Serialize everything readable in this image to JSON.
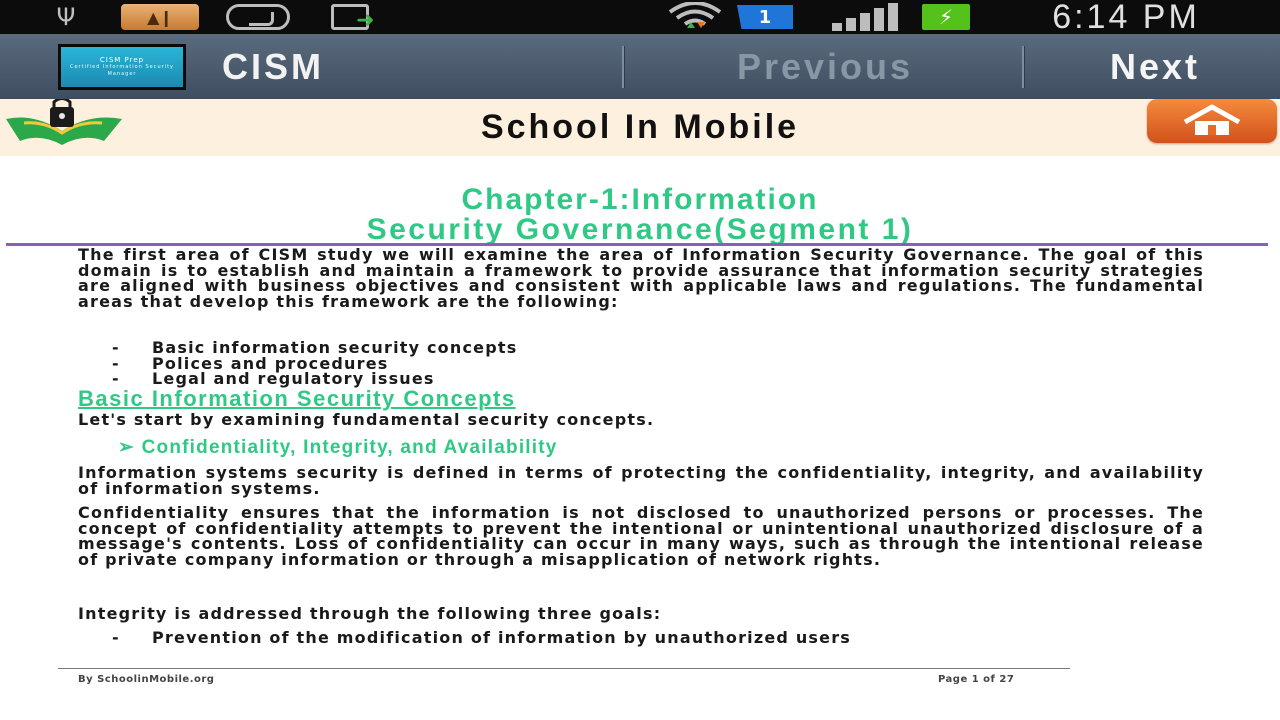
{
  "status_bar": {
    "clock": "6:14 PM",
    "notification_badge": "1",
    "icons": [
      "usb-icon",
      "app-notification-icon",
      "whatsapp-icon",
      "screenshot-icon",
      "wifi-icon",
      "notification-badge",
      "signal-icon",
      "battery-charging-icon"
    ]
  },
  "toolbar": {
    "app_title": "CISM",
    "previous_label": "Previous",
    "next_label": "Next",
    "logo_line1": "CISM Prep",
    "logo_line2": "Certified Information Security Manager"
  },
  "school_header": {
    "title": "School In Mobile",
    "home_icon": "home-icon",
    "logo_icon": "school-lock-book-icon"
  },
  "document": {
    "chapter_title_line1": "Chapter-1:Information",
    "chapter_title_line2": "Security Governance(Segment 1)",
    "intro_paragraph": "The first area of CISM study we will examine the area of Information Security Governance. The goal of this domain is to establish and maintain a framework to provide assurance that information security strategies are aligned with business objectives and consistent with applicable laws and regulations. The fundamental areas that develop this framework are the following:",
    "intro_bullets": [
      "Basic information security concepts",
      "Polices and procedures",
      "Legal and regulatory issues"
    ],
    "section_heading": "Basic Information Security Concepts",
    "section_intro": "Let's start by examining fundamental security concepts.",
    "sub_heading": "➢ Confidentiality, Integrity, and Availability",
    "paragraph_iss": "Information systems security is defined in terms of protecting the confidentiality, integrity, and availability of information systems.",
    "paragraph_confidentiality": "Confidentiality ensures that the information is not disclosed to unauthorized persons or processes. The concept of confidentiality attempts to prevent the intentional or unintentional unauthorized disclosure of a message's contents. Loss of confidentiality can occur in many ways, such as through the intentional release of private company information or through a misapplication of network rights.",
    "paragraph_integrity": "Integrity is addressed through the following three goals:",
    "integrity_bullets": [
      "Prevention of the modification of information by unauthorized users"
    ],
    "bullet_marker": "-",
    "footer_left": "By SchoolinMobile.org",
    "footer_right": "Page 1 of 27"
  },
  "colors": {
    "heading_green": "#2fc985",
    "rule_purple": "#8a5fb4",
    "toolbar_bg": "#4b5c6e",
    "header_bg": "#fdf0de",
    "home_orange": "#e8692a"
  }
}
